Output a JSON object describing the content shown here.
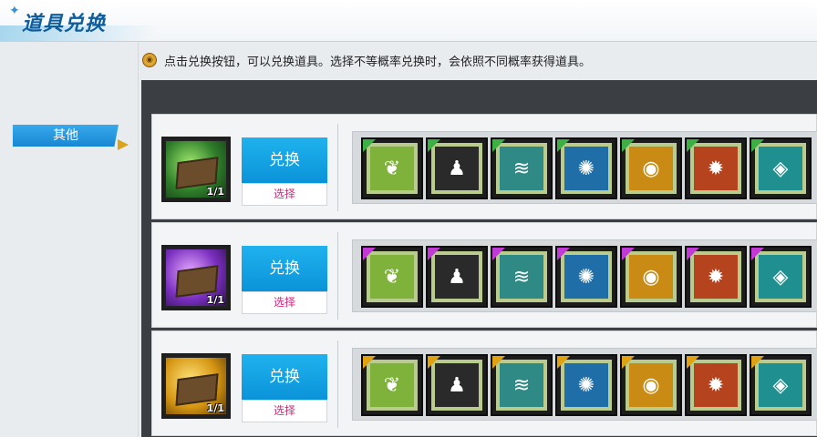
{
  "header": {
    "title": "道具兑换"
  },
  "sidebar": {
    "tabs": [
      {
        "label": "其他"
      }
    ]
  },
  "notice": {
    "icon": "coin-icon",
    "text": "点击兑换按钮，可以兑换道具。选择不等概率兑换时，会依照不同概率获得道具。"
  },
  "rows": [
    {
      "book_tone": "green",
      "count": "1/1",
      "exchange_label": "兑换",
      "select_label": "选择",
      "tag_color": "#3cb043",
      "items": [
        {
          "icon": "grass-shard-icon",
          "bg": "#7fb23a"
        },
        {
          "icon": "dark-figure-icon",
          "bg": "#2a2a2a"
        },
        {
          "icon": "whirlwind-icon",
          "bg": "#2f8a86"
        },
        {
          "icon": "blue-tornado-icon",
          "bg": "#1f6ea8"
        },
        {
          "icon": "golden-eye-icon",
          "bg": "#c98b14"
        },
        {
          "icon": "fire-crest-icon",
          "bg": "#b5431e"
        },
        {
          "icon": "teal-rune-icon",
          "bg": "#1f8f8f"
        }
      ]
    },
    {
      "book_tone": "purple",
      "count": "1/1",
      "exchange_label": "兑换",
      "select_label": "选择",
      "tag_color": "#c13ad6",
      "items": [
        {
          "icon": "grass-shard-icon",
          "bg": "#7fb23a"
        },
        {
          "icon": "dark-figure-icon",
          "bg": "#2a2a2a"
        },
        {
          "icon": "whirlwind-icon",
          "bg": "#2f8a86"
        },
        {
          "icon": "blue-tornado-icon",
          "bg": "#1f6ea8"
        },
        {
          "icon": "golden-eye-icon",
          "bg": "#c98b14"
        },
        {
          "icon": "fire-crest-icon",
          "bg": "#b5431e"
        },
        {
          "icon": "teal-rune-icon",
          "bg": "#1f8f8f"
        }
      ]
    },
    {
      "book_tone": "gold",
      "count": "1/1",
      "exchange_label": "兑换",
      "select_label": "选择",
      "tag_color": "#e0a112",
      "items": [
        {
          "icon": "grass-shard-icon",
          "bg": "#7fb23a"
        },
        {
          "icon": "dark-figure-icon",
          "bg": "#2a2a2a"
        },
        {
          "icon": "whirlwind-icon",
          "bg": "#2f8a86"
        },
        {
          "icon": "blue-tornado-icon",
          "bg": "#1f6ea8"
        },
        {
          "icon": "golden-eye-icon",
          "bg": "#c98b14"
        },
        {
          "icon": "fire-crest-icon",
          "bg": "#b5431e"
        },
        {
          "icon": "teal-rune-icon",
          "bg": "#1f8f8f"
        }
      ]
    }
  ]
}
